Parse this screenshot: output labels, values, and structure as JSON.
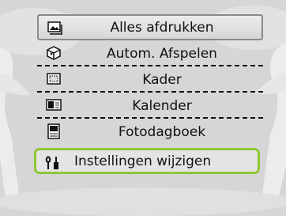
{
  "menu": {
    "items": [
      {
        "label": "Alles afdrukken",
        "icon": "print-all-icon"
      },
      {
        "label": "Autom. Afspelen",
        "icon": "auto-play-icon"
      },
      {
        "label": "Kader",
        "icon": "frame-icon"
      },
      {
        "label": "Kalender",
        "icon": "calendar-icon"
      },
      {
        "label": "Fotodagboek",
        "icon": "photo-diary-icon"
      },
      {
        "label": "Instellingen wijzigen",
        "icon": "settings-icon"
      }
    ],
    "highlighted_index": 0,
    "selected_index": 5
  },
  "colors": {
    "background": "#d9d9d9",
    "selection_border": "#92c634",
    "highlight_border": "#8a8a8a",
    "text": "#111111"
  }
}
